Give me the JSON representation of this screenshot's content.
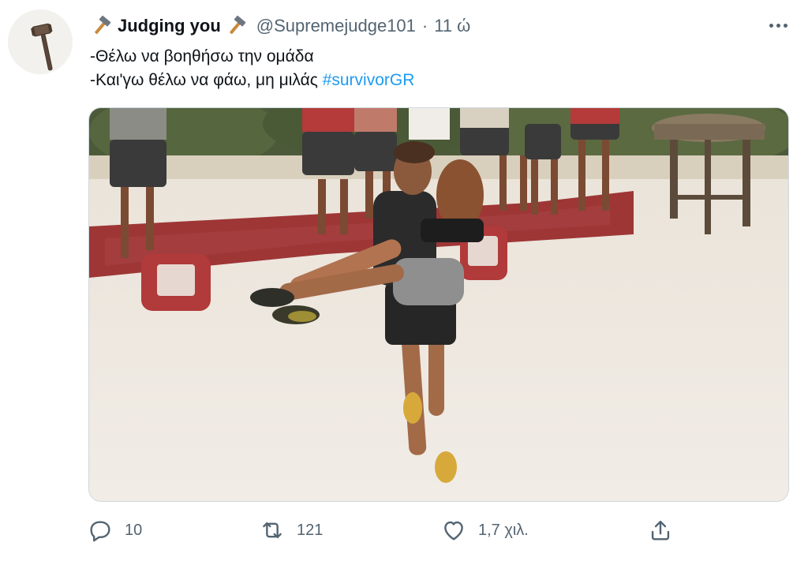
{
  "tweet": {
    "display_name": "Judging you",
    "handle": "@Supremejudge101",
    "separator": "·",
    "time": "11 ώ",
    "lines": [
      {
        "text": "-Θέλω να βοηθήσω την ομάδα"
      },
      {
        "text_before": "-Και'γω θέλω να φάω, μη μιλάς ",
        "hashtag": "#survivorGR"
      }
    ],
    "name_emoji_icon": "hammer-icon",
    "more_icon": "more-options-icon"
  },
  "actions": {
    "reply": {
      "icon": "reply-icon",
      "count": "10"
    },
    "retweet": {
      "icon": "retweet-icon",
      "count": "121"
    },
    "like": {
      "icon": "heart-icon",
      "count": "1,7 χιλ."
    },
    "share": {
      "icon": "share-icon"
    }
  },
  "colors": {
    "text": "#0f1419",
    "secondary": "#536471",
    "link": "#1d9bf0",
    "border": "#cfd9de"
  }
}
